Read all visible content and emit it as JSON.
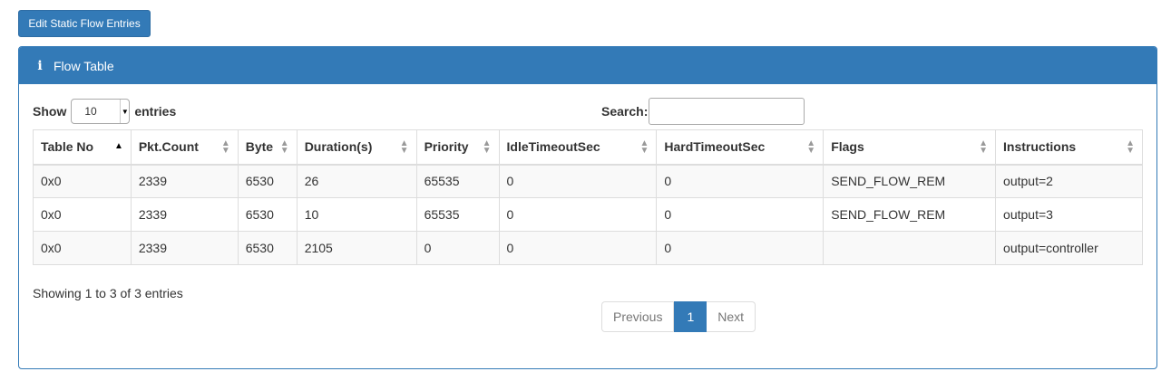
{
  "top_button": {
    "label": "Edit Static Flow Entries"
  },
  "panel": {
    "title": "Flow Table"
  },
  "length_control": {
    "show_label": "Show",
    "selected": "10",
    "entries_label": "entries"
  },
  "search": {
    "label": "Search:",
    "value": ""
  },
  "table": {
    "headers": [
      "Table No",
      "Pkt.Count",
      "Byte",
      "Duration(s)",
      "Priority",
      "IdleTimeoutSec",
      "HardTimeoutSec",
      "Flags",
      "Instructions"
    ],
    "rows": [
      [
        "0x0",
        "2339",
        "6530",
        "26",
        "65535",
        "0",
        "0",
        "SEND_FLOW_REM",
        "output=2"
      ],
      [
        "0x0",
        "2339",
        "6530",
        "10",
        "65535",
        "0",
        "0",
        "SEND_FLOW_REM",
        "output=3"
      ],
      [
        "0x0",
        "2339",
        "6530",
        "2105",
        "0",
        "0",
        "0",
        "",
        "output=controller"
      ]
    ]
  },
  "info": "Showing 1 to 3 of 3 entries",
  "pagination": {
    "previous": "Previous",
    "current": "1",
    "next": "Next"
  },
  "colors": {
    "primary": "#337ab7",
    "border": "#dddddd",
    "stripe": "#f9f9f9"
  },
  "icons": {
    "panel": "info-icon",
    "sort": "sort-icon"
  }
}
